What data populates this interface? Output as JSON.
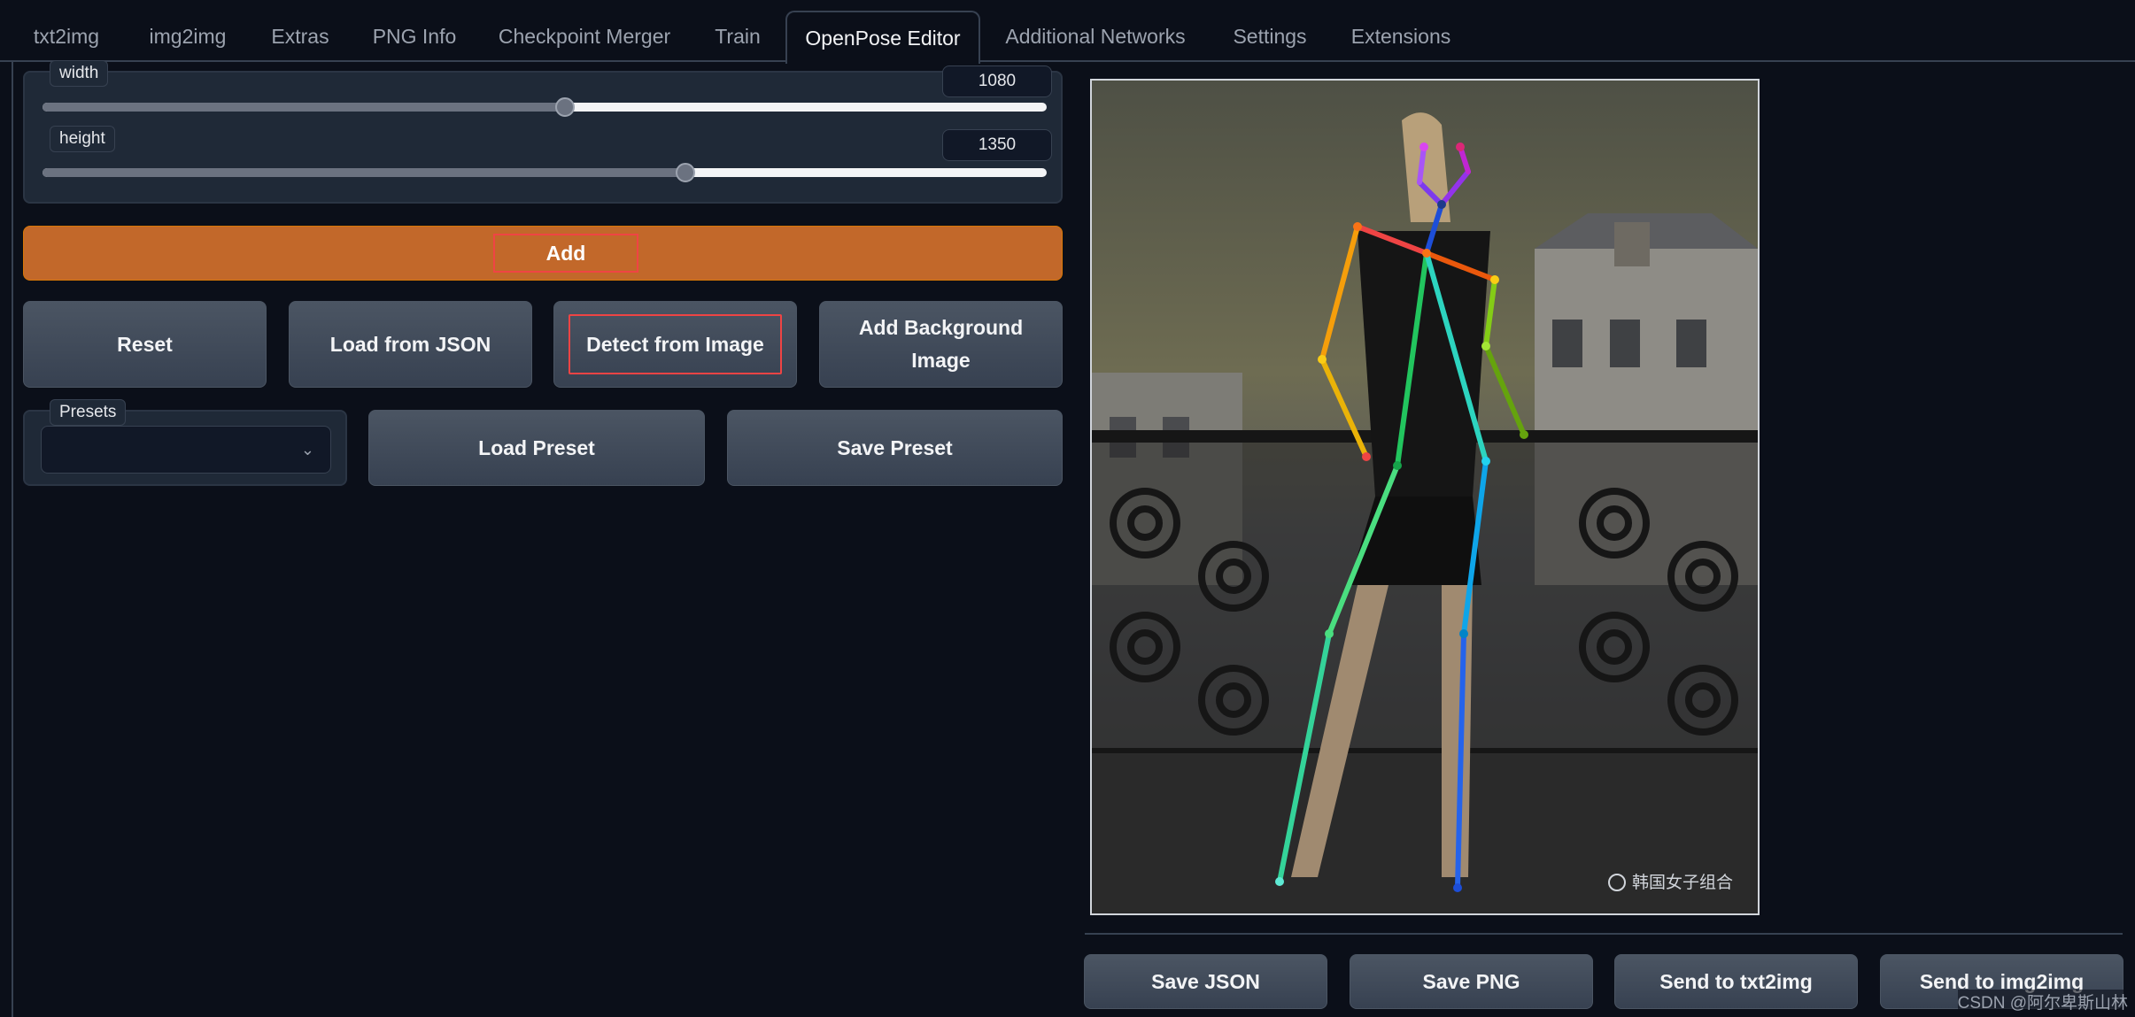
{
  "tabs": [
    {
      "label": "txt2img",
      "active": false
    },
    {
      "label": "img2img",
      "active": false
    },
    {
      "label": "Extras",
      "active": false
    },
    {
      "label": "PNG Info",
      "active": false
    },
    {
      "label": "Checkpoint Merger",
      "active": false
    },
    {
      "label": "Train",
      "active": false
    },
    {
      "label": "OpenPose Editor",
      "active": true
    },
    {
      "label": "Additional Networks",
      "active": false
    },
    {
      "label": "Settings",
      "active": false
    },
    {
      "label": "Extensions",
      "active": false
    }
  ],
  "width_slider": {
    "label": "width",
    "value": "1080",
    "fraction": 0.52
  },
  "height_slider": {
    "label": "height",
    "value": "1350",
    "fraction": 0.64
  },
  "buttons": {
    "add": "Add",
    "reset": "Reset",
    "load_json": "Load from JSON",
    "detect": "Detect from Image",
    "add_bg": "Add Background Image",
    "load_preset": "Load Preset",
    "save_preset": "Save Preset",
    "save_json": "Save JSON",
    "save_png": "Save PNG",
    "send_txt2img": "Send to txt2img",
    "send_img2img": "Send to img2img"
  },
  "presets": {
    "label": "Presets",
    "value": ""
  },
  "canvas": {
    "image_caption": "韩国女子组合",
    "colors": {
      "sky": "#6b6b52",
      "building": "#8a8a86",
      "railing": "#1c1c1c",
      "floor": "#2a2a2a"
    }
  },
  "watermark": "CSDN @阿尔卑斯山林",
  "colors": {
    "accent": "#c2682a",
    "highlight": "#ef4444",
    "background": "#0b0f19"
  }
}
